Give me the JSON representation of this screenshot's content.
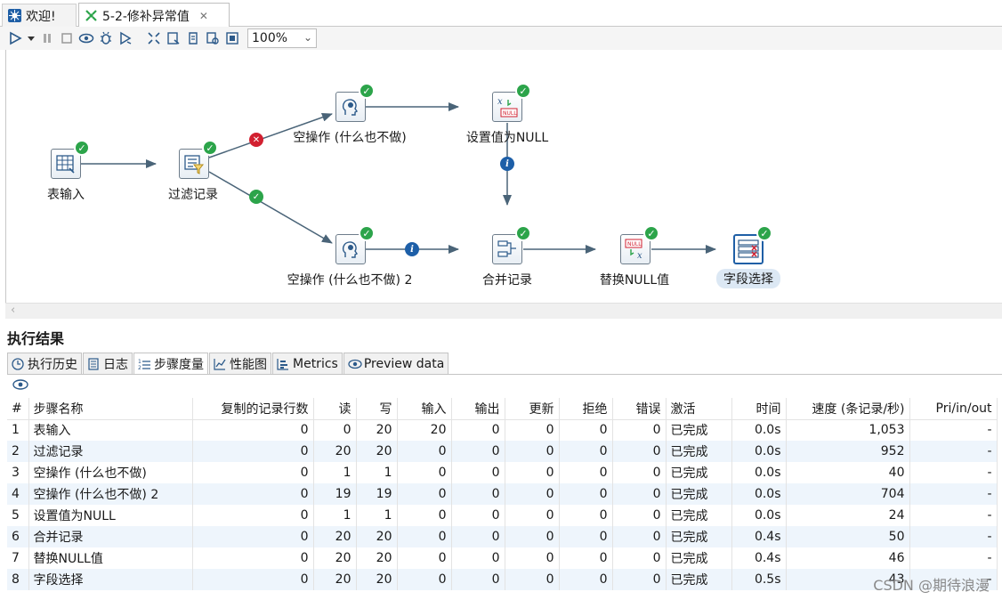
{
  "tabs": [
    {
      "label": "欢迎!"
    },
    {
      "label": "5-2-修补异常值"
    }
  ],
  "toolbar": {
    "zoom_value": "100%"
  },
  "steps": [
    {
      "label": "表输入"
    },
    {
      "label": "过滤记录"
    },
    {
      "label": "空操作 (什么也不做)"
    },
    {
      "label": "设置值为NULL"
    },
    {
      "label": "空操作 (什么也不做) 2"
    },
    {
      "label": "合并记录"
    },
    {
      "label": "替换NULL值"
    },
    {
      "label": "字段选择"
    }
  ],
  "results": {
    "title": "执行结果",
    "subtabs": [
      {
        "label": "执行历史"
      },
      {
        "label": "日志"
      },
      {
        "label": "步骤度量"
      },
      {
        "label": "性能图"
      },
      {
        "label": "Metrics"
      },
      {
        "label": "Preview data"
      }
    ],
    "columns": [
      "#",
      "步骤名称",
      "复制的记录行数",
      "读",
      "写",
      "输入",
      "输出",
      "更新",
      "拒绝",
      "错误",
      "激活",
      "时间",
      "速度 (条记录/秒)",
      "Pri/in/out"
    ],
    "rows": [
      [
        "1",
        "表输入",
        "0",
        "0",
        "20",
        "20",
        "0",
        "0",
        "0",
        "0",
        "已完成",
        "0.0s",
        "1,053",
        "-"
      ],
      [
        "2",
        "过滤记录",
        "0",
        "20",
        "20",
        "0",
        "0",
        "0",
        "0",
        "0",
        "已完成",
        "0.0s",
        "952",
        "-"
      ],
      [
        "3",
        "空操作 (什么也不做)",
        "0",
        "1",
        "1",
        "0",
        "0",
        "0",
        "0",
        "0",
        "已完成",
        "0.0s",
        "40",
        "-"
      ],
      [
        "4",
        "空操作 (什么也不做) 2",
        "0",
        "19",
        "19",
        "0",
        "0",
        "0",
        "0",
        "0",
        "已完成",
        "0.0s",
        "704",
        "-"
      ],
      [
        "5",
        "设置值为NULL",
        "0",
        "1",
        "1",
        "0",
        "0",
        "0",
        "0",
        "0",
        "已完成",
        "0.0s",
        "24",
        "-"
      ],
      [
        "6",
        "合并记录",
        "0",
        "20",
        "20",
        "0",
        "0",
        "0",
        "0",
        "0",
        "已完成",
        "0.4s",
        "50",
        "-"
      ],
      [
        "7",
        "替换NULL值",
        "0",
        "20",
        "20",
        "0",
        "0",
        "0",
        "0",
        "0",
        "已完成",
        "0.4s",
        "46",
        "-"
      ],
      [
        "8",
        "字段选择",
        "0",
        "20",
        "20",
        "0",
        "0",
        "0",
        "0",
        "0",
        "已完成",
        "0.5s",
        "43",
        "-"
      ]
    ]
  },
  "watermark": "CSDN @期待浪漫",
  "colors": {
    "link": "#4a6478",
    "ok": "#2ca44a",
    "error": "#d22030",
    "info": "#1d5fa8",
    "row_alt": "#eef5fc"
  }
}
